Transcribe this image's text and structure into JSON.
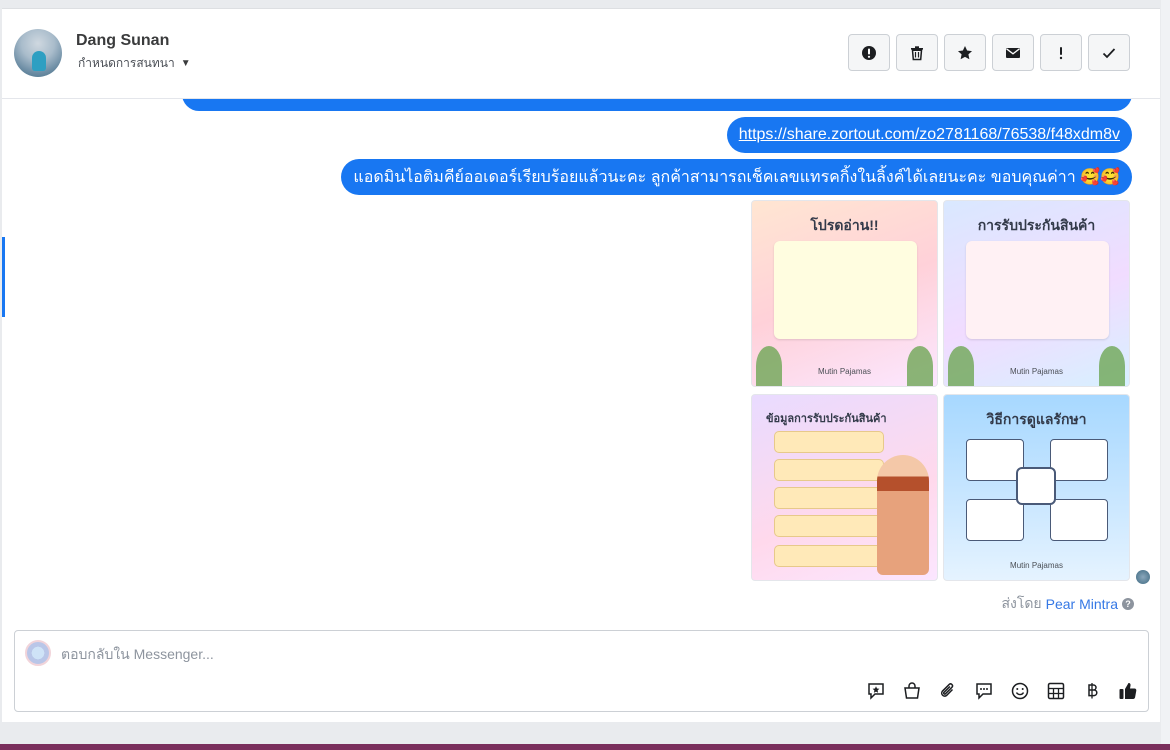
{
  "header": {
    "contact_name": "Dang Sunan",
    "assign_label": "กำหนดการสนทนา",
    "actions": [
      {
        "name": "spam-report-button",
        "icon": "alert-circle-icon"
      },
      {
        "name": "delete-button",
        "icon": "trash-icon"
      },
      {
        "name": "star-button",
        "icon": "star-icon"
      },
      {
        "name": "mark-unread-button",
        "icon": "envelope-icon"
      },
      {
        "name": "follow-up-button",
        "icon": "exclamation-icon"
      },
      {
        "name": "mark-done-button",
        "icon": "check-icon"
      }
    ]
  },
  "thread": {
    "link_message": "https://share.zortout.com/zo2781168/76538/f48xdm8v",
    "text_message": "แอดมินไอติมคีย์ออเดอร์เรียบร้อยแล้วนะคะ ลูกค้าสามารถเช็คเลขแทรคกิ้งในลิ้งค์ได้เลยนะคะ ขอบคุณค่าา 🥰🥰",
    "images": [
      {
        "title": "โปรดอ่าน!!",
        "brand": "Mutin Pajamas"
      },
      {
        "title": "การรับประกันสินค้า",
        "brand": "Mutin Pajamas"
      },
      {
        "title": "ข้อมูลการรับประกันสินค้า",
        "brand": ""
      },
      {
        "title": "วิธีการดูแลรักษา",
        "brand": "Mutin Pajamas"
      }
    ],
    "sent_by_prefix": "ส่งโดย",
    "sent_by_name": "Pear Mintra"
  },
  "composer": {
    "placeholder": "ตอบกลับใน Messenger...",
    "tools": [
      "saved-reply-icon",
      "shopping-bag-icon",
      "attachment-icon",
      "comment-icon",
      "emoji-icon",
      "table-icon",
      "baht-icon",
      "like-icon"
    ]
  },
  "colors": {
    "accent": "#1877f2",
    "bubble_text": "#ffffff",
    "link": "#3578e5"
  }
}
